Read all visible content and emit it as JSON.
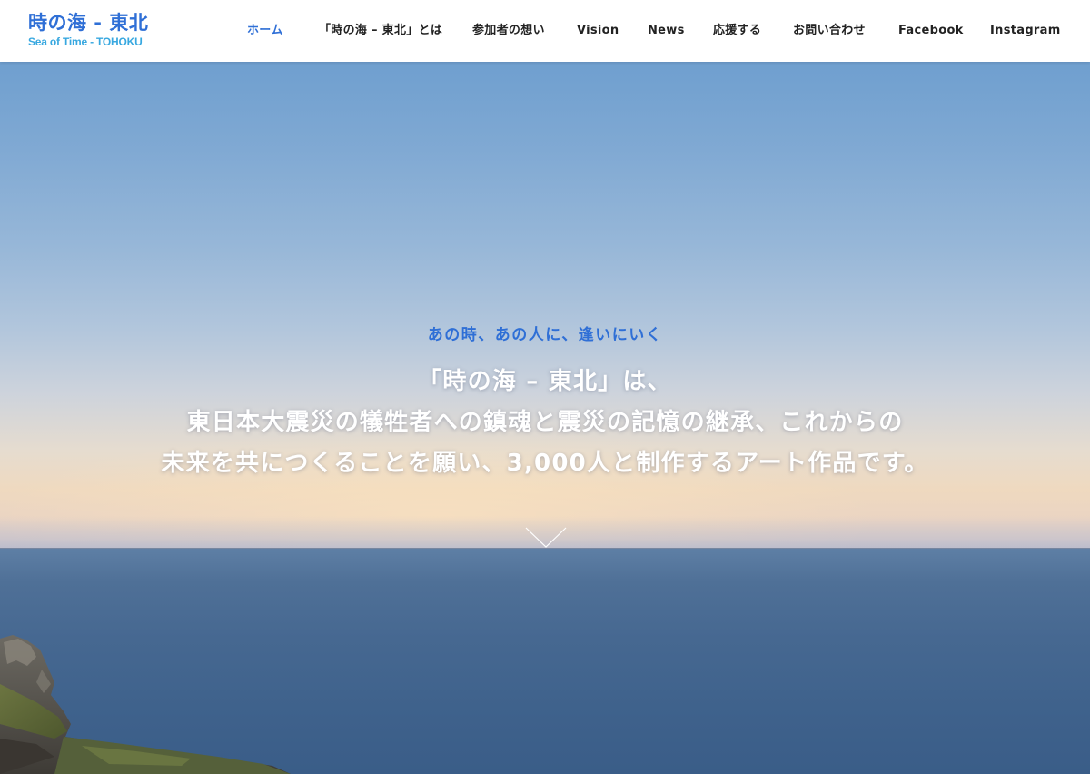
{
  "site": {
    "logo_ja": "時の海 - 東北",
    "logo_en": "Sea of Time - TOHOKU"
  },
  "nav": {
    "items": [
      {
        "label": "ホーム",
        "active": true
      },
      {
        "label": "「時の海 – 東北」とは"
      },
      {
        "label": "参加者の想い"
      },
      {
        "label": "Vision"
      },
      {
        "label": "News"
      },
      {
        "label": "応援する"
      },
      {
        "label": "お問い合わせ"
      },
      {
        "label": "Facebook"
      },
      {
        "label": "Instagram"
      }
    ]
  },
  "hero": {
    "tagline": "あの時、あの人に、逢いにいく",
    "lines": [
      "「時の海 – 東北」は、",
      "東日本大震災の犠牲者への鎮魂と震災の記憶の継承、これからの",
      "未来を共につくることを願い、3,000人と制作するアート作品です。"
    ],
    "scroll_icon": "chevron-down-icon"
  },
  "colors": {
    "accent": "#2f6fd6",
    "logo_sub": "#38a8e0",
    "nav_text": "#222222",
    "headline": "#ffffff"
  }
}
